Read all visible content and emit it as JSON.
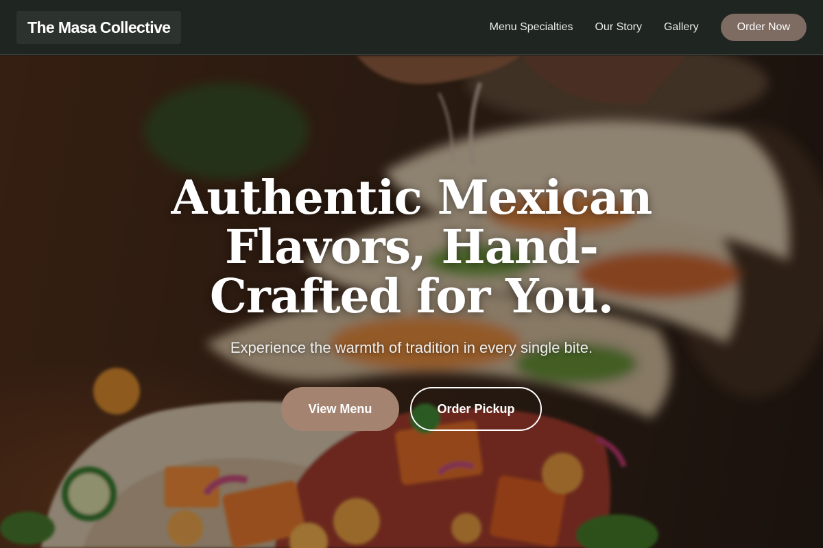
{
  "header": {
    "brand": "The Masa Collective",
    "nav": [
      "Menu Specialties",
      "Our Story",
      "Gallery"
    ],
    "cta": "Order Now"
  },
  "hero": {
    "title": "Authentic Mexican Flavors, Hand-Crafted for You.",
    "subtitle": "Experience the warmth of tradition in every single bite.",
    "primary_button": "View Menu",
    "secondary_button": "Order Pickup",
    "background_image": "tacos-food-photo"
  },
  "colors": {
    "header_bg": "#1f2521",
    "brand_bg": "#2c322e",
    "cta_bg": "#7e6b62",
    "primary_button_bg": "#a48471",
    "text": "#ffffff"
  }
}
